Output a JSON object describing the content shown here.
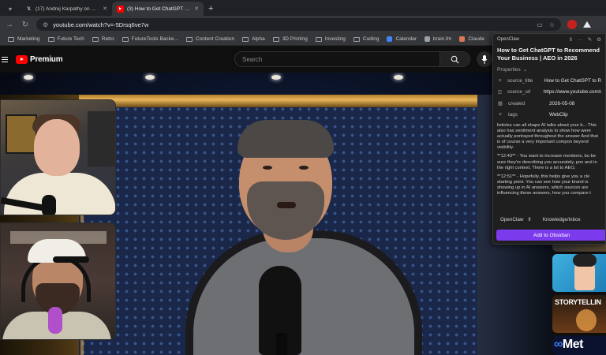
{
  "browser": {
    "tabs": [
      {
        "title": "(17) Andrej Karpathy on X: \"L",
        "active": false,
        "icon": "x-logo-icon"
      },
      {
        "title": "(3) How to Get ChatGPT to R",
        "active": true,
        "icon": "youtube-icon"
      }
    ],
    "new_tab": "+",
    "url": "youtube.com/watch?v=-5Drsq6ve7w",
    "bookmarks": [
      {
        "label": "Marketing",
        "icon": "folder-icon"
      },
      {
        "label": "Future Tech",
        "icon": "folder-icon"
      },
      {
        "label": "Retro",
        "icon": "folder-icon"
      },
      {
        "label": "FutureTools Backe...",
        "icon": "folder-icon"
      },
      {
        "label": "Content Creation",
        "icon": "folder-icon"
      },
      {
        "label": "Alpha",
        "icon": "folder-icon"
      },
      {
        "label": "3D Printing",
        "icon": "folder-icon"
      },
      {
        "label": "Investing",
        "icon": "folder-icon"
      },
      {
        "label": "Coding",
        "icon": "folder-icon"
      },
      {
        "label": "Calendar",
        "icon": "calendar-icon"
      },
      {
        "label": "brain.fm",
        "icon": "brainfm-icon"
      },
      {
        "label": "Claude",
        "icon": "claude-icon"
      },
      {
        "label": "Pe",
        "icon": "bookmark-icon"
      }
    ]
  },
  "youtube": {
    "logo_text": "Premium",
    "search_placeholder": "Search"
  },
  "thumbnails": {
    "partial_top": "",
    "storytelling": "STORYTELLIN",
    "meta": "Met"
  },
  "clipper": {
    "vault": "OpenClaw",
    "title": "How to Get ChatGPT to Recommend Your Business | AEO in 2026",
    "properties_label": "Properties",
    "properties": [
      {
        "key": "source_title",
        "value": "How to Get ChatGPT to Reco",
        "icon": "text-icon"
      },
      {
        "key": "source_url",
        "value": "https://www.youtube.com/watc",
        "icon": "list-icon"
      },
      {
        "key": "created",
        "value": "2026-05-08",
        "icon": "calendar-icon"
      },
      {
        "key": "tags",
        "value": "WebClip",
        "icon": "tag-icon"
      }
    ],
    "body": [
      "listicles can all shape AI talks about your b... This also has sentiment analysis to show how were actually portrayed throughout the answer And that is of course a very important compon beyond visibility.",
      "**12:43** - You want to increase mentions, bu be sure they're describing you accurately, pos and in the right context. There is a lot to AEO,",
      "**12:51** - Hopefully, this helps give you a cle starting point. You can see how your brand is showing up in AI answers, which sources are influencing those answers, how you compare t"
    ],
    "vault_select": "OpenClaw",
    "folder": "Knowledge/inbox",
    "add_button": "Add to Obsidian",
    "accent": "#7c3aed"
  },
  "colors": {
    "youtube_red": "#ff0000",
    "chrome_dark": "#202124",
    "chrome_toolbar": "#35363a"
  }
}
